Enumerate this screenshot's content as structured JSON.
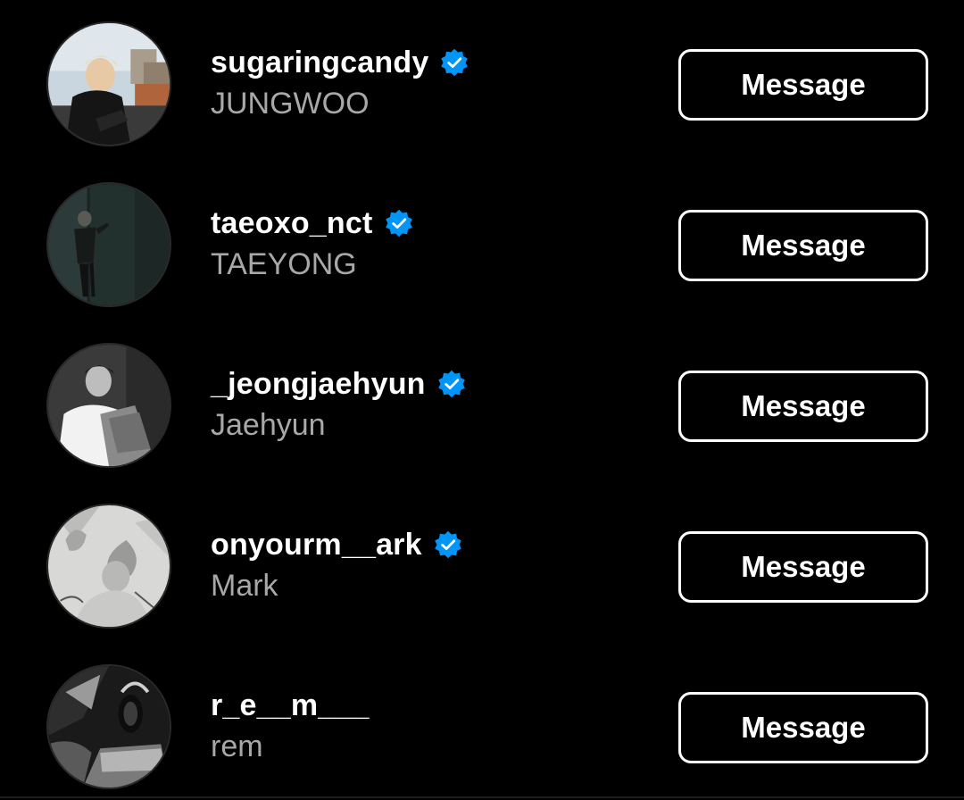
{
  "accounts": [
    {
      "username": "sugaringcandy",
      "full_name": "JUNGWOO",
      "verified": true,
      "button_label": "Message",
      "avatar_icon": "profile-photo-rooftop"
    },
    {
      "username": "taeoxo_nct",
      "full_name": "TAEYONG",
      "verified": true,
      "button_label": "Message",
      "avatar_icon": "profile-photo-dark-room"
    },
    {
      "username": "_jeongjaehyun",
      "full_name": "Jaehyun",
      "verified": true,
      "button_label": "Message",
      "avatar_icon": "profile-photo-monochrome"
    },
    {
      "username": "onyourm__ark",
      "full_name": "Mark",
      "verified": true,
      "button_label": "Message",
      "avatar_icon": "profile-photo-sketch"
    },
    {
      "username": "r_e__m___",
      "full_name": "rem",
      "verified": false,
      "button_label": "Message",
      "avatar_icon": "profile-photo-headphones"
    }
  ],
  "colors": {
    "background": "#000000",
    "username": "#ffffff",
    "full_name": "#a8a8a8",
    "verified_badge": "#0095f6",
    "button_border": "#ffffff"
  }
}
